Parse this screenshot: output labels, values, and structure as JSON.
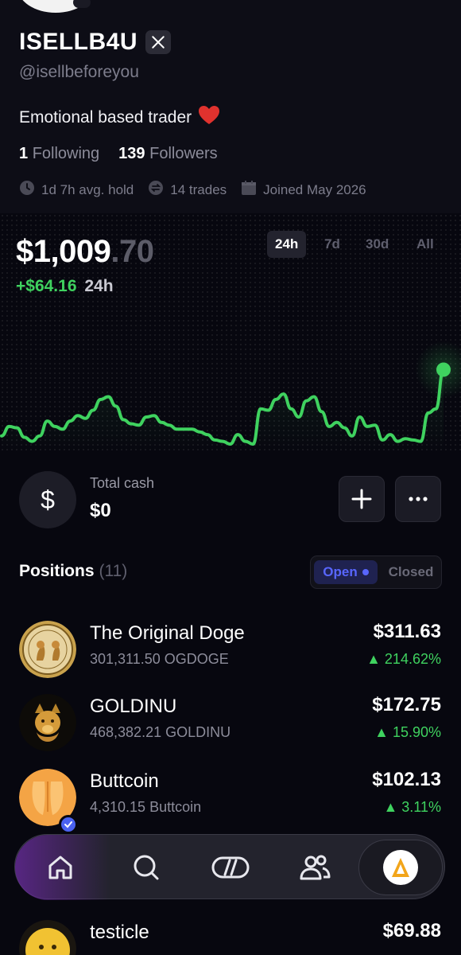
{
  "profile": {
    "name": "ISELLB4U",
    "handle": "@isellbeforeyou",
    "bio": "Emotional based trader",
    "bio_emoji": "❤️",
    "following_count": "1",
    "following_label": "Following",
    "followers_count": "139",
    "followers_label": "Followers",
    "avg_hold": "1d 7h avg. hold",
    "trades": "14 trades",
    "joined": "Joined May 2026"
  },
  "portfolio": {
    "balance_main": "$1,009",
    "balance_cents": ".70",
    "change_amount": "+$64.16",
    "change_period": "24h",
    "timeframes": [
      "24h",
      "7d",
      "30d",
      "All"
    ],
    "active_timeframe": "24h",
    "line_color": "#3fd25f"
  },
  "chart_data": {
    "type": "line",
    "title": "",
    "xlabel": "",
    "ylabel": "",
    "ylim": [
      0,
      100
    ],
    "grid": false,
    "values": [
      6,
      13,
      12,
      5,
      2,
      6,
      17,
      13,
      11,
      17,
      21,
      19,
      25,
      33,
      35,
      28,
      18,
      15,
      14,
      20,
      21,
      16,
      14,
      11,
      11,
      11,
      9,
      7,
      3,
      2,
      0,
      7,
      2,
      0,
      26,
      25,
      33,
      37,
      26,
      20,
      32,
      35,
      24,
      13,
      16,
      12,
      6,
      20,
      13,
      14,
      3,
      7,
      2,
      4,
      3,
      2,
      23,
      26,
      55
    ]
  },
  "cash": {
    "label": "Total cash",
    "value": "$0",
    "symbol": "$"
  },
  "positions": {
    "title": "Positions",
    "count": "(11)",
    "tab_open": "Open",
    "tab_closed": "Closed",
    "items": [
      {
        "name": "The Original Doge",
        "amount": "301,311.50 OGDOGE",
        "value": "$311.63",
        "change": "▲ 214.62%"
      },
      {
        "name": "GOLDINU",
        "amount": "468,382.21 GOLDINU",
        "value": "$172.75",
        "change": "▲ 15.90%"
      },
      {
        "name": "Buttcoin",
        "amount": "4,310.15 Buttcoin",
        "value": "$102.13",
        "change": "▲ 3.11%"
      },
      {
        "name": "testicle",
        "amount": "",
        "value": "$69.88",
        "change": ""
      }
    ]
  },
  "nav": {
    "items": [
      "home-icon",
      "search-icon",
      "trade-icon",
      "people-icon",
      "profile-avatar"
    ]
  }
}
